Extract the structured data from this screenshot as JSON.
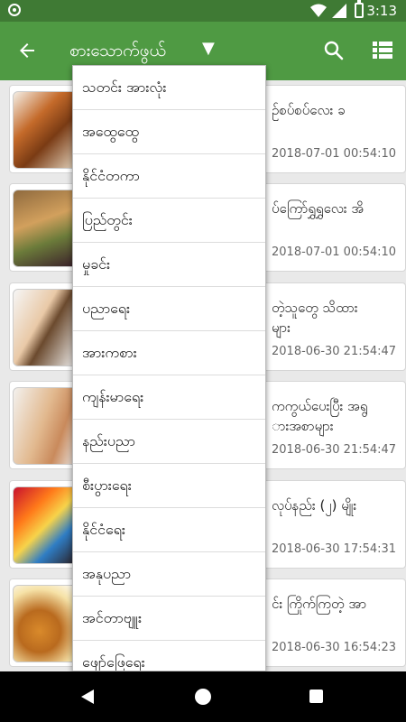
{
  "status_bar": {
    "time": "3:13"
  },
  "app_bar": {
    "title": "စားသောက်ဖွယ်",
    "caret": "▼"
  },
  "dropdown": {
    "items": [
      {
        "label": "သတင်း အားလုံး"
      },
      {
        "label": "အထွေထွေ"
      },
      {
        "label": "နိုင်ငံတကာ"
      },
      {
        "label": "ပြည်တွင်း"
      },
      {
        "label": "မှုခင်း"
      },
      {
        "label": "ပညာရေး"
      },
      {
        "label": "အားကစား"
      },
      {
        "label": "ကျန်းမာရေး"
      },
      {
        "label": "နည်းပညာ"
      },
      {
        "label": "စီးပွားရေး"
      },
      {
        "label": "နိုင်ငံရေး"
      },
      {
        "label": "အနုပညာ"
      },
      {
        "label": "အင်တာဗျူး"
      },
      {
        "label": "ဖျော်ဖြေရေး"
      }
    ]
  },
  "articles": [
    {
      "title": "ဥ်စပ်စပ်လေး ခ",
      "date": "2018-07-01 00:54:10"
    },
    {
      "title": "ပ်ကြော်ရွှရွှလေး အိ",
      "date": "2018-07-01 00:54:10"
    },
    {
      "title": "တဲ့သူတွေ သိထား\nများ",
      "date": "2018-06-30 21:54:47"
    },
    {
      "title": "ကကွယ်ပေးပြီး အရွ\nားအစာများ",
      "date": "2018-06-30 21:54:47"
    },
    {
      "title": "လုပ်နည်း (၂) မျိုး",
      "date": "2018-06-30 17:54:31"
    },
    {
      "title": "င်း ကြိုက်ကြတဲ့ အာ",
      "date": "2018-06-30 16:54:23"
    }
  ]
}
